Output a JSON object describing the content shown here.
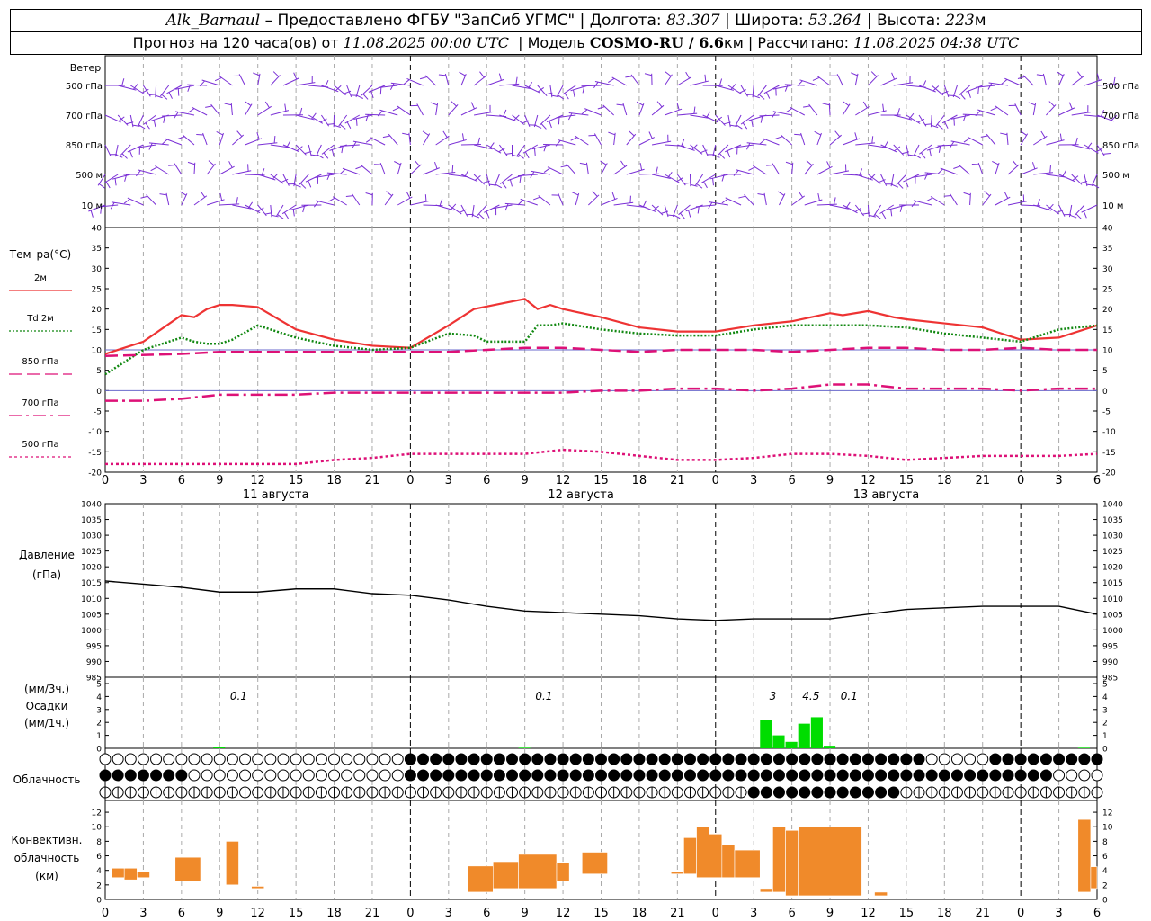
{
  "header": {
    "station": "Alk_Barnaul",
    "dash": " – ",
    "provider": "Предоставлено ФГБУ \"ЗапСиб УГМС\"",
    "lon_label": " | Долгота: ",
    "lon": "83.307",
    "lat_label": " | Широта: ",
    "lat": "53.264",
    "alt_label": " | Высота: ",
    "alt": "223",
    "alt_unit": "м",
    "forecast_prefix": "Прогноз на 120 часа(ов) от ",
    "forecast_start": "11.08.2025 00:00 UTC",
    "model_label": "  | Модель ",
    "model": "COSMO-RU / 6.6",
    "model_unit": "км",
    "computed_label": " | Рассчитано: ",
    "computed": "11.08.2025 04:38 UTC"
  },
  "labels": {
    "wind": "Ветер",
    "wind_levels": [
      "500 гПа",
      "700 гПа",
      "850 гПа",
      "500 м",
      "10 м"
    ],
    "temp_title": "Тем–ра(°C)",
    "temp_legend": [
      {
        "label": "2м",
        "color": "#ee3333",
        "style": "solid"
      },
      {
        "label": "Td  2м",
        "color": "#118811",
        "style": "dot"
      },
      {
        "label": "850 гПа",
        "color": "#dd1177",
        "style": "dash"
      },
      {
        "label": "700 гПа",
        "color": "#dd1177",
        "style": "dashdot"
      },
      {
        "label": "500 гПа",
        "color": "#dd1177",
        "style": "dotfine"
      }
    ],
    "pressure": "Давление",
    "pressure_unit": "(гПа)",
    "precip_unit3": "(мм/3ч.)",
    "precip": "Осадки",
    "precip_unit1": "(мм/1ч.)",
    "cloud": "Облачность",
    "conv1": "Конвективн.",
    "conv2": "облачность",
    "conv3": "(км)"
  },
  "chart_data": {
    "type": "line",
    "x_unit": "hours since 11.08.2025 00:00 UTC",
    "x_tick_labels": [
      "0",
      "3",
      "6",
      "9",
      "12",
      "15",
      "18",
      "21",
      "0",
      "3",
      "6",
      "9",
      "12",
      "15",
      "18",
      "21",
      "0",
      "3",
      "6",
      "9",
      "12",
      "15",
      "18",
      "21",
      "0",
      "3",
      "6"
    ],
    "day_labels": [
      "11 августа",
      "12 августа",
      "13 августа"
    ],
    "wind_colors": {
      "barb": "#7a2fd6"
    },
    "temperature": {
      "ylim": [
        -20,
        40
      ],
      "y_ticks": [
        40,
        35,
        30,
        25,
        20,
        15,
        10,
        5,
        0,
        -5,
        -10,
        -15,
        -20
      ],
      "series": [
        {
          "name": "2м",
          "color": "#ee3333",
          "x": [
            0,
            3,
            6,
            7,
            8,
            9,
            10,
            12,
            15,
            18,
            21,
            24,
            27,
            29,
            33,
            34,
            35,
            36,
            39,
            42,
            45,
            48,
            51,
            54,
            57,
            58,
            60,
            62,
            63,
            66,
            69,
            72,
            75,
            78
          ],
          "values": [
            9,
            12,
            18.5,
            18,
            20,
            21,
            21,
            20.5,
            15,
            12.5,
            11,
            10.5,
            16,
            20,
            22.5,
            20,
            21,
            20,
            18,
            15.5,
            14.5,
            14.5,
            16,
            17,
            19,
            18.5,
            19.5,
            18,
            17.5,
            16.5,
            15.5,
            12.5,
            13,
            16
          ]
        },
        {
          "name": "Td  2м",
          "color": "#118811",
          "x": [
            0,
            3,
            6,
            7,
            8,
            9,
            10,
            12,
            15,
            18,
            21,
            24,
            27,
            29,
            30,
            33,
            34,
            35,
            36,
            39,
            42,
            45,
            48,
            51,
            54,
            57,
            60,
            63,
            66,
            69,
            72,
            75,
            78
          ],
          "values": [
            4,
            10,
            13,
            12,
            11.5,
            11.5,
            12.5,
            16,
            13,
            11,
            10,
            10.5,
            14,
            13.5,
            12,
            12,
            16,
            16,
            16.5,
            15,
            14,
            13.5,
            13.5,
            15,
            16,
            16,
            16,
            15.5,
            14,
            13,
            12,
            15,
            16
          ]
        },
        {
          "name": "850 гПа",
          "color": "#dd1177",
          "x": [
            0,
            6,
            9,
            12,
            15,
            18,
            21,
            24,
            27,
            30,
            33,
            36,
            39,
            42,
            45,
            48,
            51,
            54,
            57,
            60,
            63,
            66,
            69,
            72,
            75,
            78
          ],
          "values": [
            8.5,
            9,
            9.5,
            9.5,
            9.5,
            9.5,
            9.5,
            9.5,
            9.5,
            10,
            10.5,
            10.5,
            10,
            9.5,
            10,
            10,
            10,
            9.5,
            10,
            10.5,
            10.5,
            10,
            10,
            10.5,
            10,
            10
          ]
        },
        {
          "name": "700 гПа",
          "color": "#dd1177",
          "x": [
            0,
            3,
            6,
            9,
            12,
            15,
            18,
            21,
            24,
            27,
            30,
            33,
            36,
            39,
            42,
            45,
            48,
            51,
            54,
            57,
            60,
            63,
            66,
            69,
            72,
            75,
            78
          ],
          "values": [
            -2.5,
            -2.5,
            -2,
            -1,
            -1,
            -1,
            -0.5,
            -0.5,
            -0.5,
            -0.5,
            -0.5,
            -0.5,
            -0.5,
            0,
            0,
            0.5,
            0.5,
            0,
            0.5,
            1.5,
            1.5,
            0.5,
            0.5,
            0.5,
            0,
            0.5,
            0.5
          ]
        },
        {
          "name": "500 гПа",
          "color": "#dd1177",
          "x": [
            0,
            3,
            6,
            9,
            12,
            15,
            18,
            21,
            24,
            27,
            30,
            33,
            36,
            39,
            42,
            45,
            48,
            51,
            54,
            57,
            60,
            63,
            66,
            69,
            72,
            75,
            78
          ],
          "values": [
            -18,
            -18,
            -18,
            -18,
            -18,
            -18,
            -17,
            -16.5,
            -15.5,
            -15.5,
            -15.5,
            -15.5,
            -14.5,
            -15,
            -16,
            -17,
            -17,
            -16.5,
            -15.5,
            -15.5,
            -16,
            -17,
            -16.5,
            -16,
            -16,
            -16,
            -15.5
          ]
        }
      ]
    },
    "pressure": {
      "ylim": [
        985,
        1040
      ],
      "y_ticks": [
        1040,
        1035,
        1030,
        1025,
        1020,
        1015,
        1010,
        1005,
        1000,
        995,
        990,
        985
      ],
      "color": "#000000",
      "x": [
        0,
        3,
        6,
        9,
        12,
        15,
        18,
        21,
        24,
        27,
        30,
        33,
        36,
        39,
        42,
        45,
        48,
        51,
        54,
        57,
        60,
        63,
        66,
        69,
        72,
        75,
        78
      ],
      "values": [
        1015.5,
        1014.5,
        1013.5,
        1012,
        1012,
        1013,
        1013,
        1011.5,
        1011,
        1009.5,
        1007.5,
        1006,
        1005.5,
        1005,
        1004.5,
        1003.5,
        1003,
        1003.5,
        1003.5,
        1003.5,
        1005,
        1006.5,
        1007,
        1007.5,
        1007.5,
        1007.5,
        1005
      ]
    },
    "precipitation": {
      "ylim": [
        0,
        5
      ],
      "y_ticks": [
        5,
        4,
        3,
        2,
        1,
        0
      ],
      "color": "#00dd00",
      "bars": [
        {
          "x": 9,
          "value": 0.1
        },
        {
          "x": 33,
          "value": 0.05
        },
        {
          "x": 52,
          "value": 2.2
        },
        {
          "x": 53,
          "value": 1
        },
        {
          "x": 54,
          "value": 0.5
        },
        {
          "x": 55,
          "value": 1.9
        },
        {
          "x": 56,
          "value": 2.4
        },
        {
          "x": 57,
          "value": 0.2
        },
        {
          "x": 77,
          "value": 0.05
        }
      ],
      "sums": [
        {
          "x": 10.5,
          "label": "0.1"
        },
        {
          "x": 34.5,
          "label": "0.1"
        },
        {
          "x": 52.5,
          "label": "3"
        },
        {
          "x": 55.5,
          "label": "4.5"
        },
        {
          "x": 58.5,
          "label": "0.1"
        }
      ]
    },
    "convective": {
      "ylim": [
        0,
        13
      ],
      "y_ticks": [
        12,
        10,
        8,
        6,
        4,
        2,
        0
      ],
      "color": "#f08a2a",
      "bars": [
        {
          "x0": 0.5,
          "x1": 1.5,
          "lo": 3,
          "hi": 4.3
        },
        {
          "x0": 1.5,
          "x1": 2.5,
          "lo": 2.7,
          "hi": 4.3
        },
        {
          "x0": 2.5,
          "x1": 3.5,
          "lo": 3,
          "hi": 3.8
        },
        {
          "x0": 5.5,
          "x1": 7.5,
          "lo": 2.5,
          "hi": 5.8
        },
        {
          "x0": 9.5,
          "x1": 10.5,
          "lo": 2,
          "hi": 8
        },
        {
          "x0": 11.5,
          "x1": 12.5,
          "lo": 1.5,
          "hi": 1.8
        },
        {
          "x0": 28.5,
          "x1": 30.5,
          "lo": 1,
          "hi": 4.6
        },
        {
          "x0": 30.5,
          "x1": 32.5,
          "lo": 1.5,
          "hi": 5.2
        },
        {
          "x0": 32.5,
          "x1": 35.5,
          "lo": 1.5,
          "hi": 6.2
        },
        {
          "x0": 35.5,
          "x1": 36.5,
          "lo": 2.5,
          "hi": 5
        },
        {
          "x0": 37.5,
          "x1": 39.5,
          "lo": 3.5,
          "hi": 6.5
        },
        {
          "x0": 44.5,
          "x1": 45.5,
          "lo": 3.5,
          "hi": 3.8
        },
        {
          "x0": 45.5,
          "x1": 46.5,
          "lo": 3.5,
          "hi": 8.5
        },
        {
          "x0": 46.5,
          "x1": 47.5,
          "lo": 3,
          "hi": 10
        },
        {
          "x0": 47.5,
          "x1": 48.5,
          "lo": 3,
          "hi": 9
        },
        {
          "x0": 48.5,
          "x1": 49.5,
          "lo": 3,
          "hi": 7.5
        },
        {
          "x0": 49.5,
          "x1": 51.5,
          "lo": 3,
          "hi": 6.8
        },
        {
          "x0": 51.5,
          "x1": 52.5,
          "lo": 1,
          "hi": 1.5
        },
        {
          "x0": 52.5,
          "x1": 53.5,
          "lo": 1,
          "hi": 10
        },
        {
          "x0": 53.5,
          "x1": 54.5,
          "lo": 0.5,
          "hi": 9.5
        },
        {
          "x0": 54.5,
          "x1": 59.5,
          "lo": 0.5,
          "hi": 10
        },
        {
          "x0": 60.5,
          "x1": 61.5,
          "lo": 0.5,
          "hi": 1
        },
        {
          "x0": 76.5,
          "x1": 77.5,
          "lo": 1,
          "hi": 11
        },
        {
          "x0": 77.5,
          "x1": 78,
          "lo": 1.5,
          "hi": 4.5
        }
      ]
    },
    "cloud_rows": {
      "count": 3,
      "per_row": 79,
      "overcast_ranges": [
        [
          [
            24,
            47
          ],
          [
            48,
            64
          ],
          [
            70,
            78
          ]
        ],
        [
          [
            0,
            6
          ],
          [
            24,
            74
          ]
        ],
        [
          [
            51,
            62
          ]
        ]
      ]
    }
  }
}
